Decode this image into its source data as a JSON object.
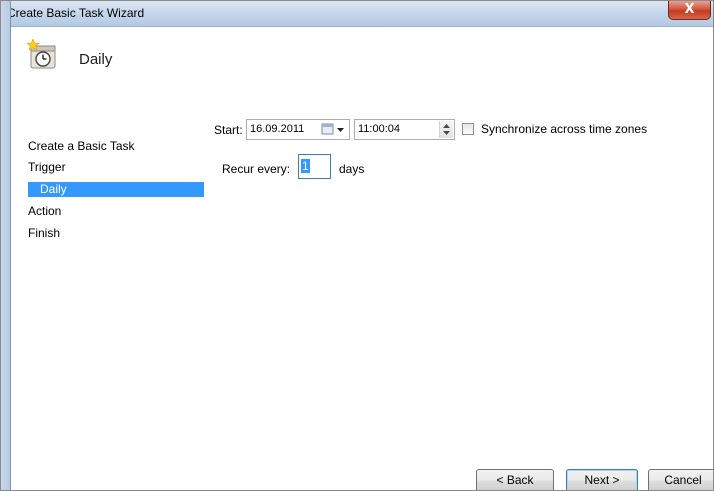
{
  "window": {
    "title": "Create Basic Task Wizard",
    "close_glyph": "X"
  },
  "header": {
    "title": "Daily",
    "icon": "clock-task-icon"
  },
  "nav": {
    "items": [
      {
        "label": "Create a Basic Task",
        "selected": false
      },
      {
        "label": "Trigger",
        "selected": false
      },
      {
        "label": "Daily",
        "selected": true
      },
      {
        "label": "Action",
        "selected": false
      },
      {
        "label": "Finish",
        "selected": false
      }
    ]
  },
  "trigger": {
    "start_label": "Start:",
    "start_date": "16.09.2011",
    "start_time": "11:00:04",
    "sync_label": "Synchronize across time zones",
    "sync_checked": false,
    "recur_label": "Recur every:",
    "recur_value": "1",
    "recur_unit": "days"
  },
  "buttons": {
    "back": "< Back",
    "next": "Next >",
    "cancel": "Cancel"
  },
  "colors": {
    "selection": "#3399ff",
    "titlebar": "#c6d7eb",
    "close": "#c23c22"
  }
}
